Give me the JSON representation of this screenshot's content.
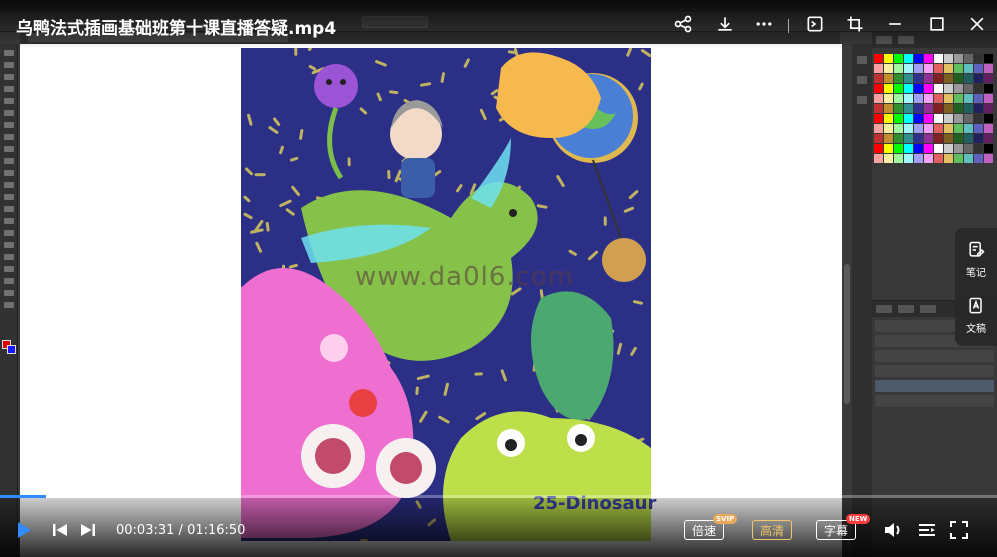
{
  "player": {
    "title": "乌鸭法式插画基础班第十课直播答疑.mp4",
    "current_time": "00:03:31",
    "duration": "01:16:50",
    "time_separator": "/",
    "progress": 0.0458,
    "speed_label": "倍速",
    "speed_badge": "SVIP",
    "quality_label": "高清",
    "subtitle_label": "字幕",
    "subtitle_badge": "NEW",
    "side_notes_label": "笔记",
    "side_manuscript_label": "文稿",
    "accent_color": "#2f8dff"
  },
  "top_icons": [
    "share-icon",
    "download-icon",
    "more-icon",
    "screenshot-icon",
    "crop-icon",
    "minimize-icon",
    "maximize-icon",
    "close-icon"
  ],
  "artwork": {
    "watermark": "www.da0l6.com",
    "caption": "25-Dinosaur"
  }
}
